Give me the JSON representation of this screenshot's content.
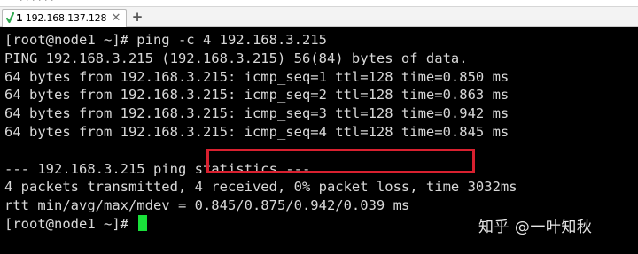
{
  "tabbar": {
    "cut_text": "· · · · · ·",
    "tab_number": "1",
    "tab_title": "192.168.137.128",
    "close_icon": "close-icon",
    "new_tab_icon": "plus-icon",
    "status_icon": "checkmark-icon",
    "status_color": "#2fa84f"
  },
  "terminal": {
    "lines": [
      "[root@node1 ~]# ping -c 4 192.168.3.215",
      "PING 192.168.3.215 (192.168.3.215) 56(84) bytes of data.",
      "64 bytes from 192.168.3.215: icmp_seq=1 ttl=128 time=0.850 ms",
      "64 bytes from 192.168.3.215: icmp_seq=2 ttl=128 time=0.863 ms",
      "64 bytes from 192.168.3.215: icmp_seq=3 ttl=128 time=0.942 ms",
      "64 bytes from 192.168.3.215: icmp_seq=4 ttl=128 time=0.845 ms",
      "",
      "--- 192.168.3.215 ping statistics ---",
      "4 packets transmitted, 4 received, 0% packet loss, time 3032ms",
      "rtt min/avg/max/mdev = 0.845/0.875/0.942/0.039 ms",
      "[root@node1 ~]# "
    ],
    "text_color": "#d8d8d8",
    "background": "#000000",
    "cursor_color": "#19e03a",
    "highlight_color": "#d8202f"
  },
  "watermark": "知乎 @一叶知秋"
}
